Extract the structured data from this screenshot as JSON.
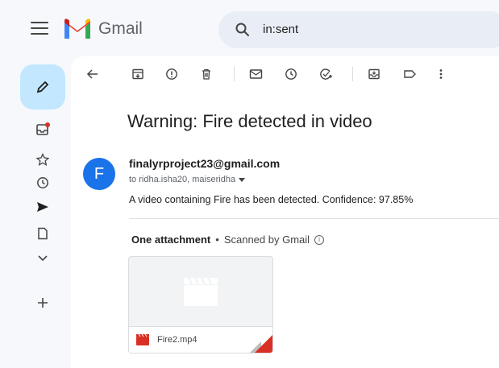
{
  "header": {
    "brand": "Gmail",
    "search_value": "in:sent"
  },
  "toolbar": {
    "icons": [
      "back-arrow-icon",
      "archive-icon",
      "report-spam-icon",
      "delete-icon",
      "mark-unread-icon",
      "snooze-icon",
      "add-to-tasks-icon",
      "move-to-icon",
      "label-icon",
      "more-options-icon"
    ]
  },
  "email": {
    "subject": "Warning: Fire detected in video",
    "avatar_letter": "F",
    "sender": "finalyrproject23@gmail.com",
    "recipients": "to ridha.isha20, maiseridha",
    "body": "A video containing Fire has been detected. Confidence: 97.85%"
  },
  "attachments": {
    "title": "One attachment",
    "separator": "•",
    "scan_note": "Scanned by Gmail",
    "files": [
      {
        "name": "Fire2.mp4"
      }
    ]
  },
  "colors": {
    "accent": "#c2e7ff",
    "avatar": "#1a73e8",
    "notification_dot": "#d93025",
    "background": "#f6f8fc"
  }
}
